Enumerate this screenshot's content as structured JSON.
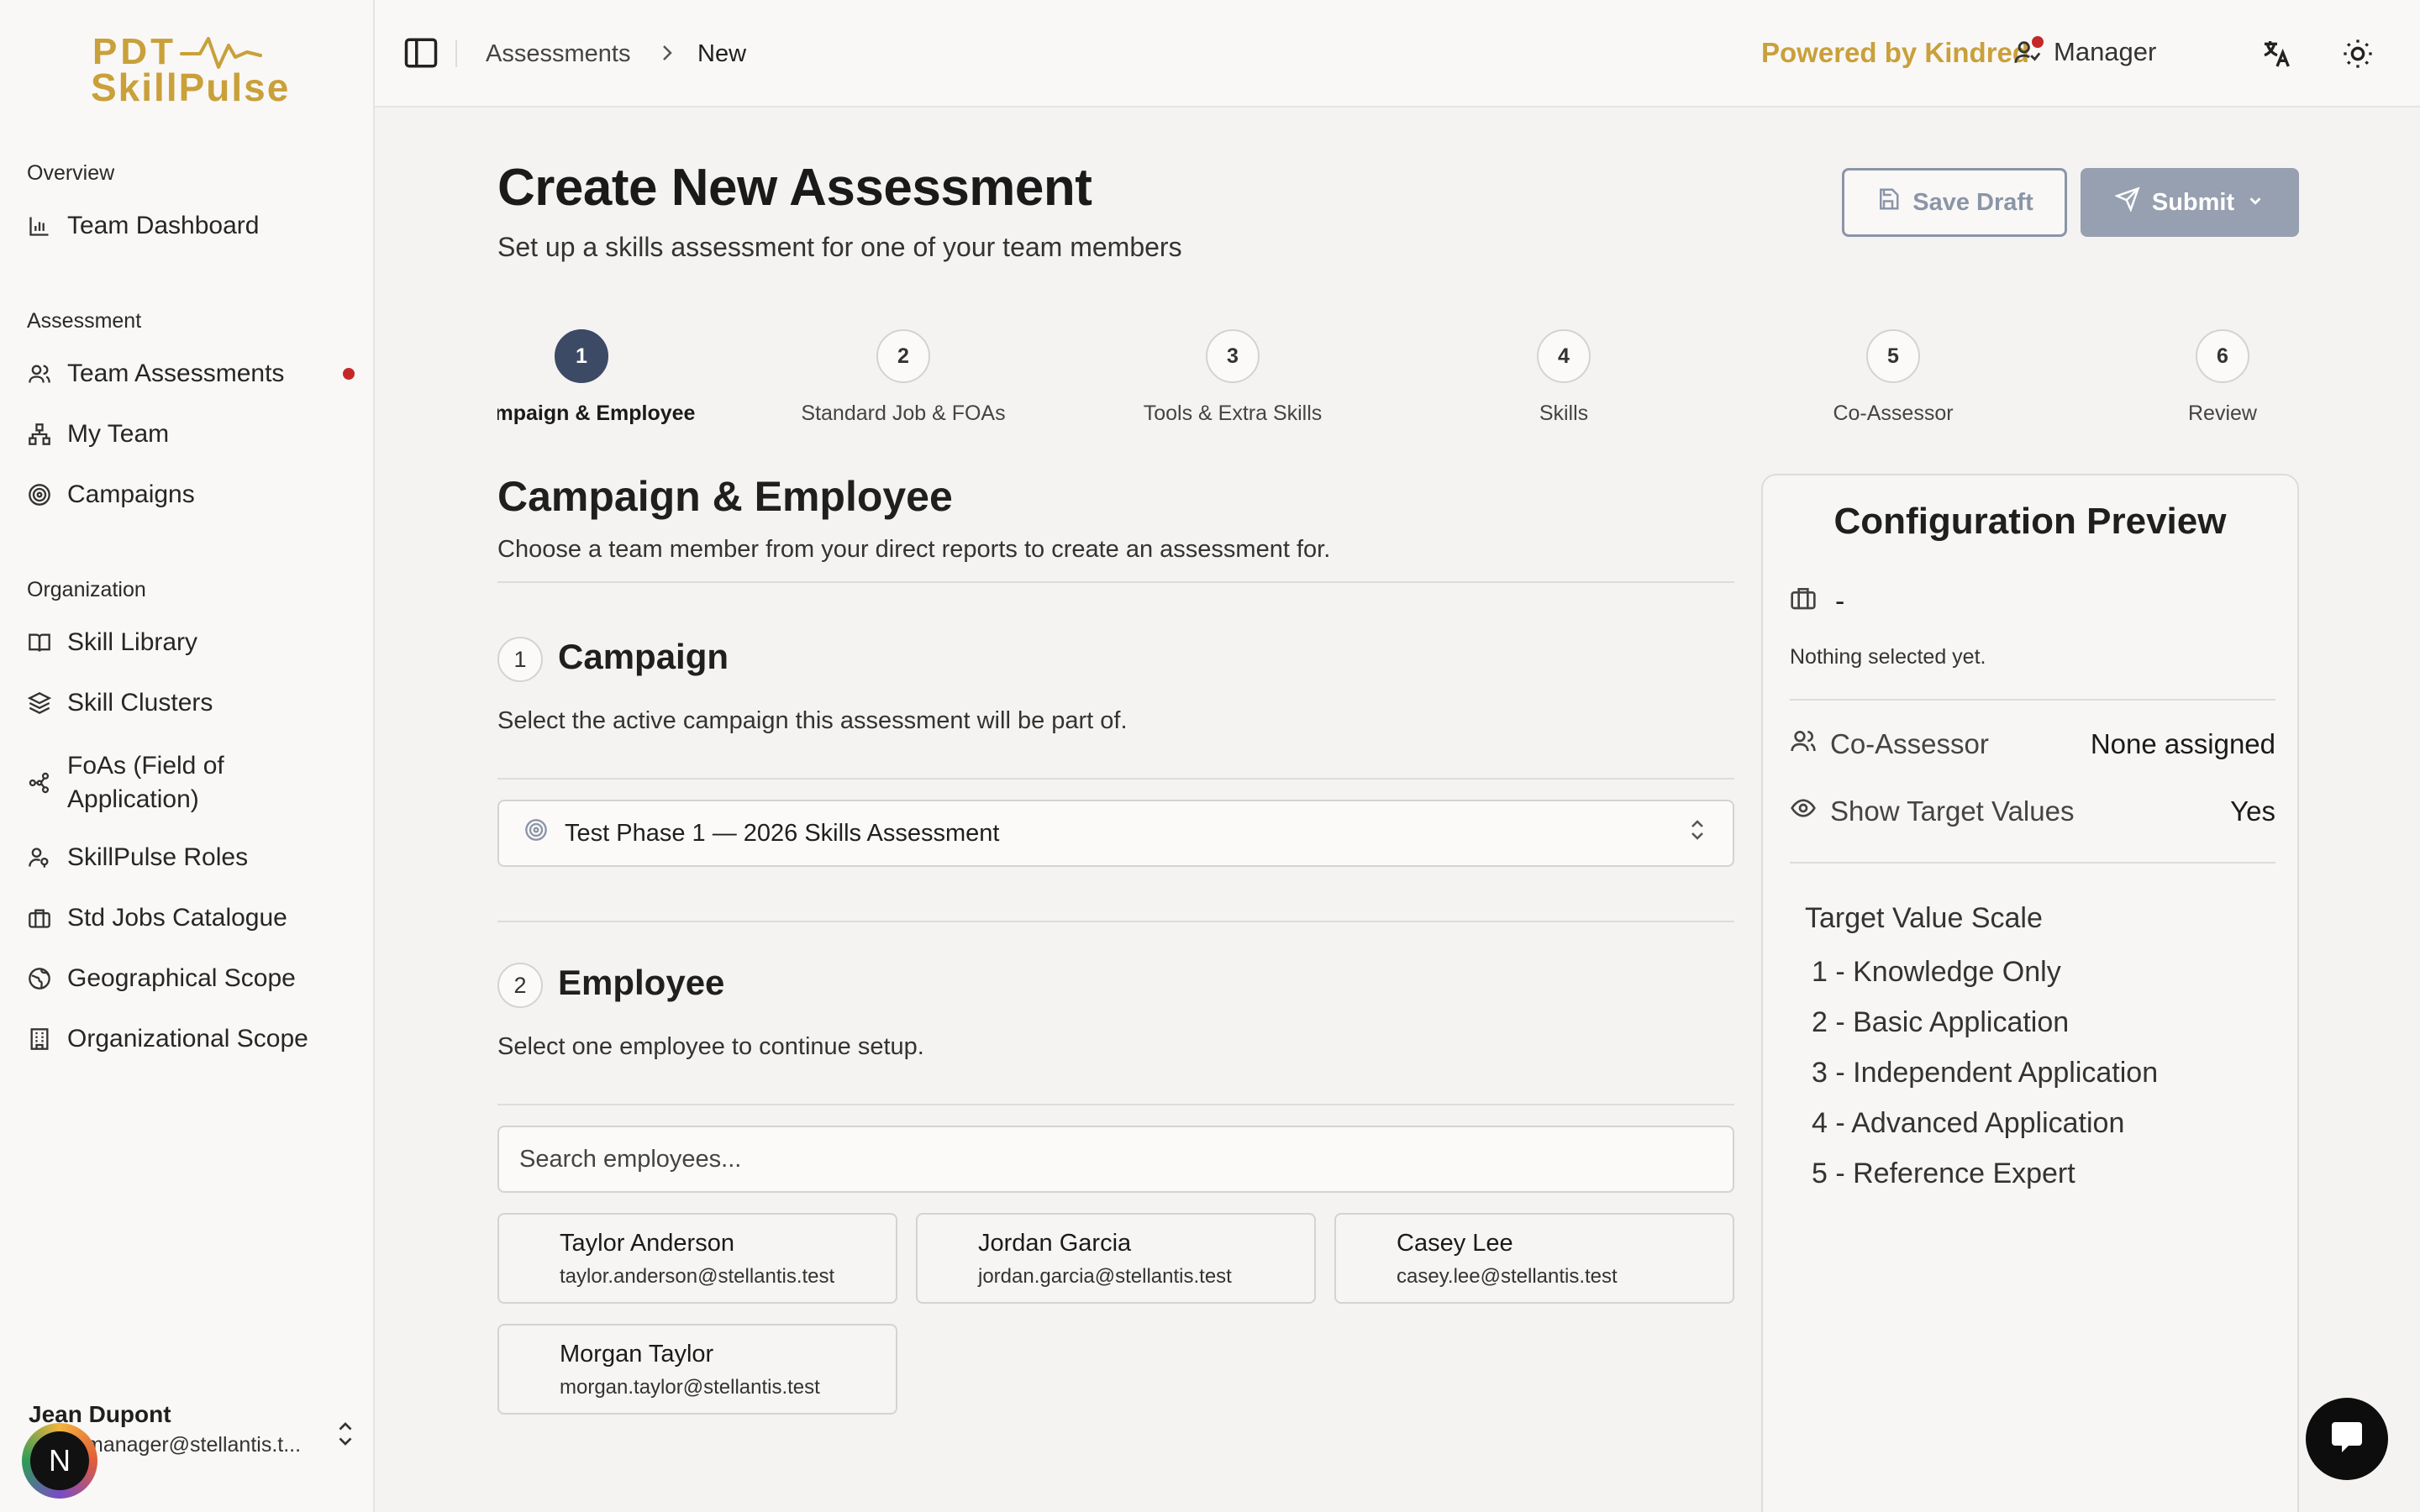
{
  "logo": {
    "line1": "PDT",
    "line2": "SkillPulse"
  },
  "sidebar": {
    "sections": [
      {
        "label": "Overview",
        "items": [
          {
            "label": "Team Dashboard",
            "icon": "bar-chart-icon"
          }
        ]
      },
      {
        "label": "Assessment",
        "items": [
          {
            "label": "Team Assessments",
            "icon": "users-icon",
            "notification": true
          },
          {
            "label": "My Team",
            "icon": "org-chart-icon"
          },
          {
            "label": "Campaigns",
            "icon": "target-icon"
          }
        ]
      },
      {
        "label": "Organization",
        "items": [
          {
            "label": "Skill Library",
            "icon": "book-open-icon"
          },
          {
            "label": "Skill Clusters",
            "icon": "layers-icon"
          },
          {
            "label": "FoAs (Field of Application)",
            "icon": "network-icon"
          },
          {
            "label": "SkillPulse Roles",
            "icon": "user-key-icon"
          },
          {
            "label": "Std Jobs Catalogue",
            "icon": "briefcase-icon"
          },
          {
            "label": "Geographical Scope",
            "icon": "globe-icon"
          },
          {
            "label": "Organizational Scope",
            "icon": "building-icon"
          }
        ]
      }
    ],
    "user": {
      "name": "Jean Dupont",
      "email": "manager@stellantis.t...",
      "avatar_initial": "N"
    }
  },
  "topbar": {
    "breadcrumb": [
      "Assessments",
      "New"
    ],
    "powered_by": "Powered by Kindred",
    "role": "Manager"
  },
  "page": {
    "title": "Create New Assessment",
    "subtitle": "Set up a skills assessment for one of your team members",
    "save_draft": "Save Draft",
    "submit": "Submit"
  },
  "steps": [
    {
      "num": "1",
      "label": "Campaign & Employee",
      "active": true
    },
    {
      "num": "2",
      "label": "Standard Job & FOAs"
    },
    {
      "num": "3",
      "label": "Tools & Extra Skills"
    },
    {
      "num": "4",
      "label": "Skills"
    },
    {
      "num": "5",
      "label": "Co-Assessor"
    },
    {
      "num": "6",
      "label": "Review"
    }
  ],
  "section": {
    "title": "Campaign & Employee",
    "subtitle": "Choose a team member from your direct reports to create an assessment for."
  },
  "campaign": {
    "num": "1",
    "title": "Campaign",
    "desc": "Select the active campaign this assessment will be part of.",
    "selected": "Test Phase 1 — 2026 Skills Assessment"
  },
  "employee": {
    "num": "2",
    "title": "Employee",
    "desc": "Select one employee to continue setup.",
    "search_placeholder": "Search employees...",
    "list": [
      {
        "name": "Taylor Anderson",
        "email": "taylor.anderson@stellantis.test"
      },
      {
        "name": "Jordan Garcia",
        "email": "jordan.garcia@stellantis.test"
      },
      {
        "name": "Casey Lee",
        "email": "casey.lee@stellantis.test"
      },
      {
        "name": "Morgan Taylor",
        "email": "morgan.taylor@stellantis.test"
      }
    ]
  },
  "preview": {
    "title": "Configuration Preview",
    "job": "-",
    "nothing": "Nothing selected yet.",
    "co_assessor_label": "Co-Assessor",
    "co_assessor_value": "None assigned",
    "target_label": "Show Target Values",
    "target_value": "Yes",
    "scale_title": "Target Value Scale",
    "scale": [
      "1 - Knowledge Only",
      "2 - Basic Application",
      "3 - Independent Application",
      "4 - Advanced Application",
      "5 - Reference Expert"
    ]
  },
  "colors": {
    "brand_gold": "#c9a03a",
    "step_active": "#3c4a66",
    "notification": "#c62828",
    "submit_disabled": "#97a0b0"
  }
}
